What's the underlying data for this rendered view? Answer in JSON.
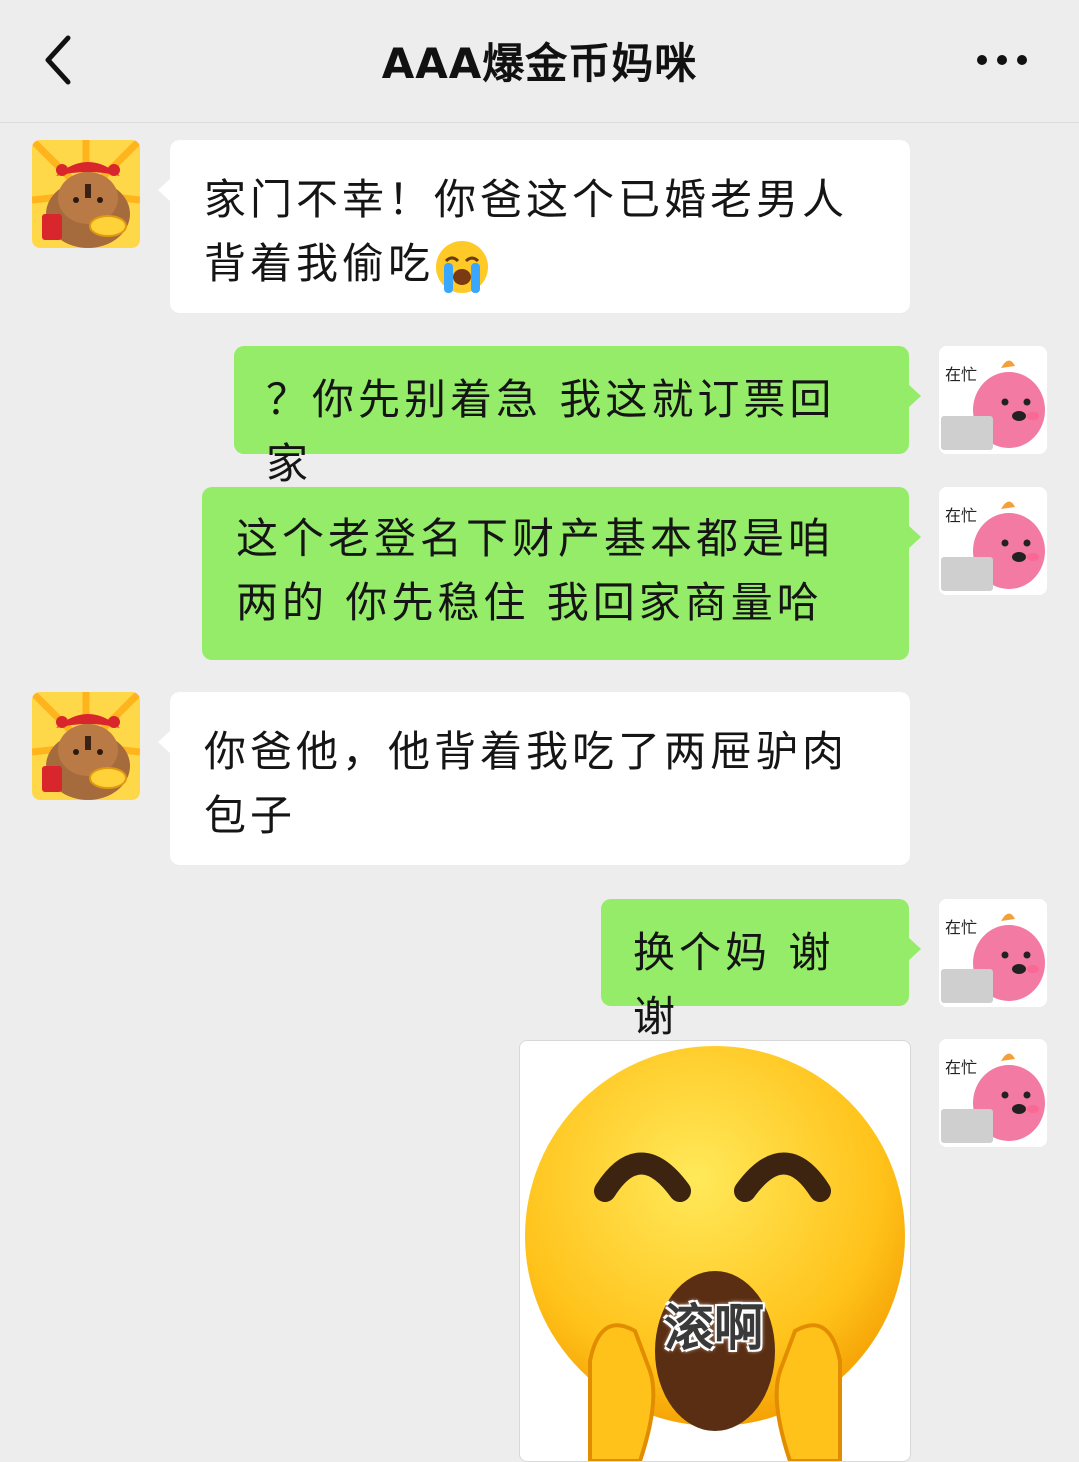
{
  "header": {
    "title": "AAA爆金币妈咪",
    "back_icon": "chevron-left-icon",
    "more_icon": "more-dots-icon"
  },
  "messages": [
    {
      "side": "in",
      "text": "家门不幸！你爸这个已婚老男人背着我偷吃",
      "emoji": "loudly-crying-face-icon"
    },
    {
      "side": "out",
      "text": "？你先别着急 我这就订票回家"
    },
    {
      "side": "out",
      "text": "这个老登名下财产基本都是咱两的 你先稳住 我回家商量哈"
    },
    {
      "side": "in",
      "text": "你爸他，他背着我吃了两屉驴肉包子"
    },
    {
      "side": "out",
      "text": "换个妈 谢谢"
    },
    {
      "side": "out",
      "type": "sticker",
      "caption": "滚啊"
    }
  ],
  "avatars": {
    "mom": {
      "icon": "capybara-avatar-icon"
    },
    "me": {
      "icon": "pink-creature-avatar-icon",
      "text": "在忙"
    }
  },
  "colors": {
    "background": "#ededed",
    "outgoing_bubble": "#95ec69",
    "incoming_bubble": "#ffffff"
  }
}
